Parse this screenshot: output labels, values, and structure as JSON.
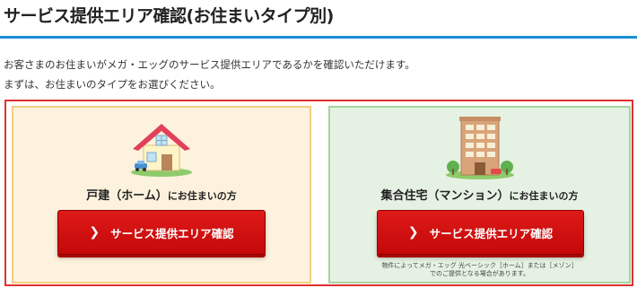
{
  "page": {
    "title": "サービス提供エリア確認(お住まいタイプ別)",
    "intro_line1": "お客さまのお住まいがメガ・エッグのサービス提供エリアであるかを確認いただけます。",
    "intro_line2": "まずは、お住まいのタイプをお選びください。"
  },
  "colors": {
    "accent_rule": "#1a8fd6",
    "frame": "#e03030",
    "button_red": "#d41010",
    "house_card_bg": "#fdf2dd",
    "apartment_card_bg": "#e5f2e3"
  },
  "cards": {
    "house": {
      "heading_main": "戸建（ホーム）",
      "heading_suffix": "にお住まいの方",
      "button_label": "サービス提供エリア確認",
      "icon": "house-icon"
    },
    "apartment": {
      "heading_main": "集合住宅（マンション）",
      "heading_suffix": "にお住まいの方",
      "button_label": "サービス提供エリア確認",
      "icon": "apartment-building-icon",
      "note_line1": "物件によってメガ・エッグ 光ベーシック［ホーム］または［メゾン］",
      "note_line2": "でのご提供となる場合があります。"
    }
  }
}
